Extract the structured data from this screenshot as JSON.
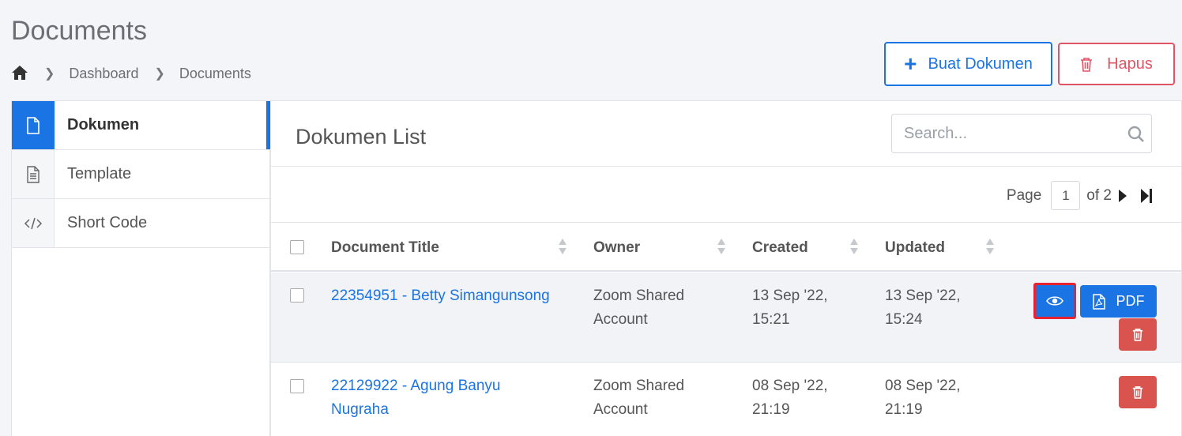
{
  "page": {
    "title": "Documents"
  },
  "breadcrumb": {
    "home_icon": "home-icon",
    "items": [
      "Dashboard",
      "Documents"
    ]
  },
  "actions": {
    "create_label": "Buat Dokumen",
    "delete_label": "Hapus"
  },
  "sidebar": {
    "items": [
      {
        "label": "Dokumen",
        "icon": "file-icon",
        "active": true
      },
      {
        "label": "Template",
        "icon": "file-text-icon",
        "active": false
      },
      {
        "label": "Short Code",
        "icon": "code-icon",
        "active": false
      }
    ]
  },
  "list": {
    "title": "Dokumen List",
    "search_placeholder": "Search...",
    "pager": {
      "page_label": "Page",
      "current": "1",
      "of_label": "of 2"
    },
    "columns": [
      "Document Title",
      "Owner",
      "Created",
      "Updated"
    ],
    "rows": [
      {
        "title": "22354951 - Betty Simangunsong",
        "owner_line1": "Zoom Shared",
        "owner_line2": "Account",
        "created_line1": "13 Sep '22,",
        "created_line2": "15:21",
        "updated_line1": "13 Sep '22,",
        "updated_line2": "15:24",
        "pdf_label": "PDF"
      },
      {
        "title_line1": "22129922 - Agung Banyu",
        "title_line2": "Nugraha",
        "owner_line1": "Zoom Shared",
        "owner_line2": "Account",
        "created_line1": "08 Sep '22,",
        "created_line2": "21:19",
        "updated_line1": "08 Sep '22,",
        "updated_line2": "21:19"
      }
    ]
  },
  "colors": {
    "primary": "#1b74e4",
    "danger": "#d9534f",
    "danger_outline": "#e05565",
    "highlight": "#e8232f"
  }
}
